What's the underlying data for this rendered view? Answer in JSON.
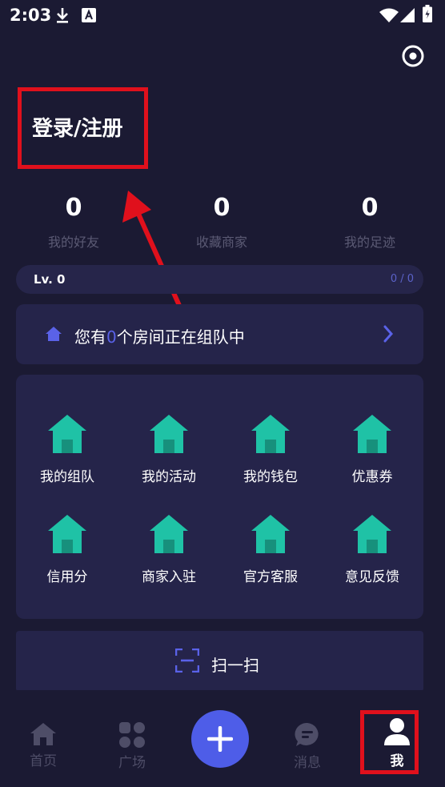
{
  "status_bar": {
    "time": "2:03",
    "icons": [
      "download-icon",
      "a-badge-icon",
      "wifi-icon",
      "signal-icon",
      "battery-icon"
    ]
  },
  "header": {
    "settings_icon": "settings-target-icon"
  },
  "login": {
    "label": "登录/注册"
  },
  "stats": [
    {
      "value": "0",
      "label": "我的好友"
    },
    {
      "value": "0",
      "label": "收藏商家"
    },
    {
      "value": "0",
      "label": "我的足迹"
    }
  ],
  "level": {
    "label": "Lv. 0",
    "progress": "0 / 0"
  },
  "team": {
    "prefix": "您有",
    "count": "0",
    "suffix": "个房间正在组队中"
  },
  "grid": [
    {
      "label": "我的组队"
    },
    {
      "label": "我的活动"
    },
    {
      "label": "我的钱包"
    },
    {
      "label": "优惠券"
    },
    {
      "label": "信用分"
    },
    {
      "label": "商家入驻"
    },
    {
      "label": "官方客服"
    },
    {
      "label": "意见反馈"
    }
  ],
  "scan": {
    "label": "扫一扫"
  },
  "nav": [
    {
      "label": "首页"
    },
    {
      "label": "广场"
    },
    {
      "label": "消息"
    },
    {
      "label": "我"
    }
  ],
  "colors": {
    "background": "#1b1a33",
    "card": "#25244a",
    "accent": "#4e5de8",
    "teal": "#1fc2a6",
    "annotation_red": "#e0101c"
  }
}
